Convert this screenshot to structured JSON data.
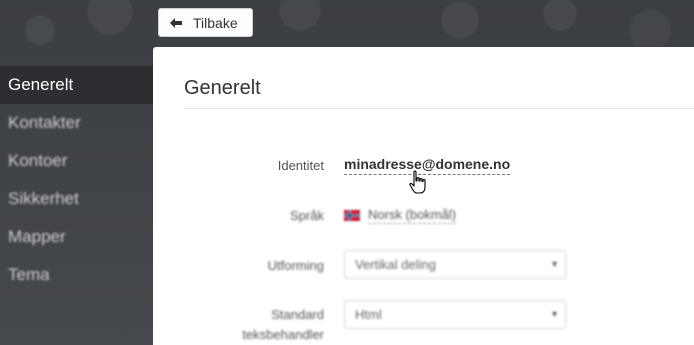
{
  "toolbar": {
    "back_label": "Tilbake"
  },
  "sidebar": {
    "items": [
      {
        "label": "Generelt",
        "active": true
      },
      {
        "label": "Kontakter"
      },
      {
        "label": "Kontoer"
      },
      {
        "label": "Sikkerhet"
      },
      {
        "label": "Mapper"
      },
      {
        "label": "Tema"
      }
    ]
  },
  "main": {
    "title": "Generelt",
    "identity": {
      "label": "Identitet",
      "value": "minadresse@domene.no"
    },
    "language": {
      "label": "Språk",
      "value": "Norsk (bokmål)"
    },
    "layout": {
      "label": "Utforming",
      "value": "Vertikal deling"
    },
    "editor": {
      "label_line1": "Standard",
      "label_line2": "teksbehandler",
      "value": "Html"
    }
  },
  "colors": {
    "sidebar_bg": "#3e4145",
    "active_item_bg": "#2c2e31",
    "panel_bg": "#ffffff"
  }
}
